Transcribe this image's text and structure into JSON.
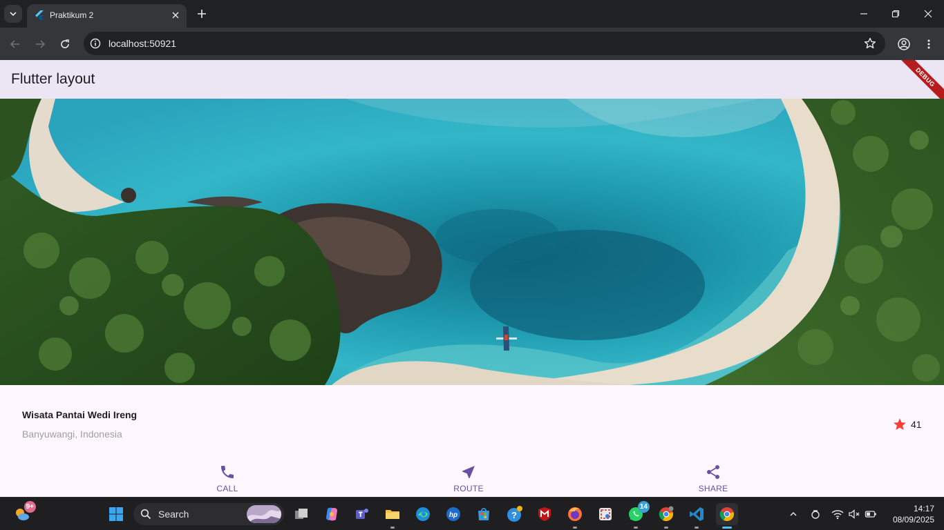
{
  "browser": {
    "tab_title": "Praktikum 2",
    "url": "localhost:50921"
  },
  "app": {
    "appbar_title": "Flutter layout",
    "debug_banner": "DEBUG",
    "place_name": "Wisata Pantai Wedi Ireng",
    "place_location": "Banyuwangi, Indonesia",
    "rating": "41",
    "accent_color": "#6750a4",
    "star_color": "#f44336",
    "actions": [
      {
        "label": "CALL",
        "icon": "phone-icon"
      },
      {
        "label": "ROUTE",
        "icon": "navigation-icon"
      },
      {
        "label": "SHARE",
        "icon": "share-icon"
      }
    ]
  },
  "taskbar": {
    "search_label": "Search",
    "weather_badge": "9+",
    "whatsapp_badge": "14",
    "time": "14:17",
    "date": "08/09/2025"
  }
}
